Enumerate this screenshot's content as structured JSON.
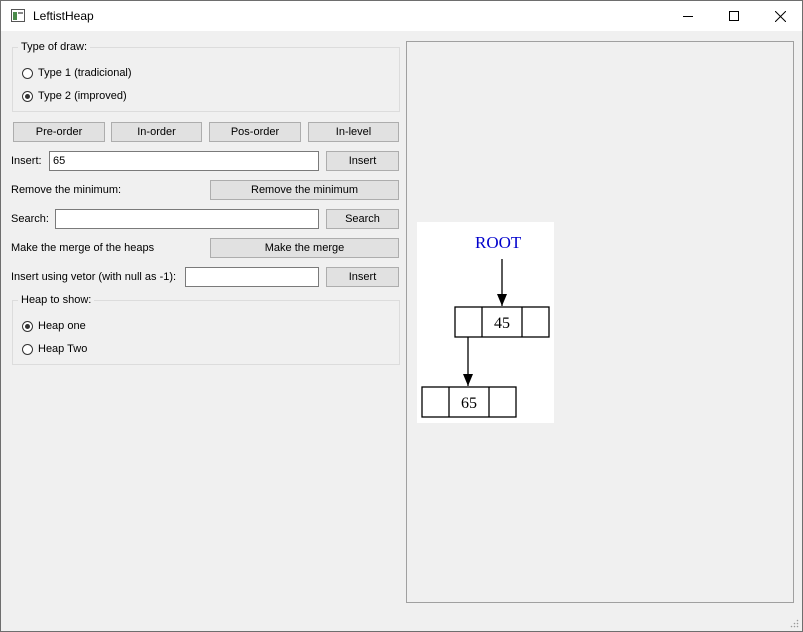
{
  "window": {
    "title": "LeftistHeap"
  },
  "draw_type": {
    "title": "Type of draw:",
    "options": [
      {
        "label": "Type 1 (tradicional)",
        "checked": false
      },
      {
        "label": "Type 2 (improved)",
        "checked": true
      }
    ]
  },
  "traversal": {
    "preorder": "Pre-order",
    "inorder": "In-order",
    "posorder": "Pos-order",
    "inlevel": "In-level"
  },
  "insert": {
    "label": "Insert:",
    "value": "65",
    "button": "Insert"
  },
  "remove_min": {
    "label": "Remove the minimum:",
    "button": "Remove the minimum"
  },
  "search": {
    "label": "Search:",
    "value": "",
    "button": "Search"
  },
  "merge": {
    "label": "Make the merge of the heaps",
    "button": "Make the merge"
  },
  "insert_vector": {
    "label": "Insert using vetor (with null as -1):",
    "value": "",
    "button": "Insert"
  },
  "heap_to_show": {
    "title": "Heap to show:",
    "options": [
      {
        "label": "Heap one",
        "checked": true
      },
      {
        "label": "Heap Two",
        "checked": false
      }
    ]
  },
  "tree": {
    "root_label": "ROOT",
    "root_color": "#0000cc",
    "nodes": {
      "root_value": "45",
      "left_value": "65"
    }
  }
}
